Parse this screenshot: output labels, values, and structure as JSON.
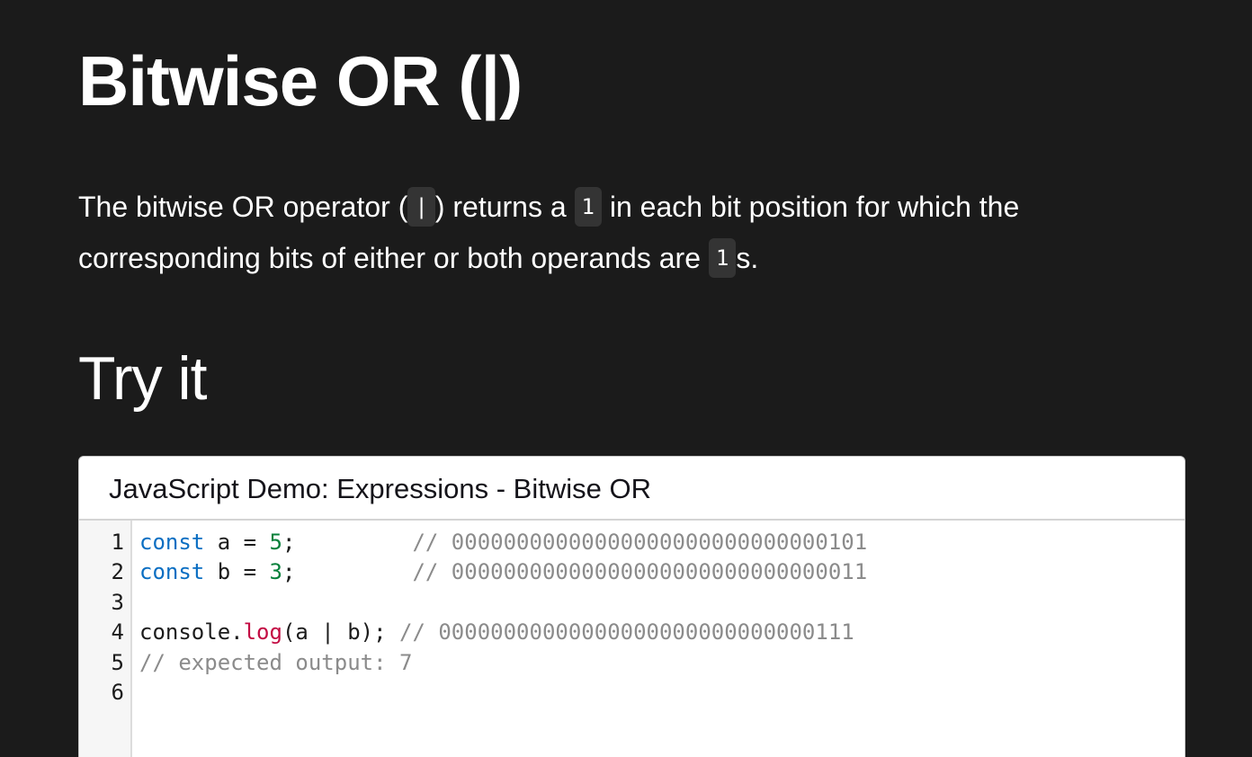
{
  "page": {
    "title": "Bitwise OR (|)",
    "intro": {
      "part1": "The bitwise OR operator (",
      "code1": "|",
      "part2": ") returns a ",
      "code2": "1",
      "part3": " in each bit position for which the corresponding bits of either or both operands are ",
      "code3": "1",
      "part4": "s."
    },
    "try_it_heading": "Try it"
  },
  "demo": {
    "header": "JavaScript Demo: Expressions - Bitwise OR",
    "line_numbers": [
      "1",
      "2",
      "3",
      "4",
      "5",
      "6"
    ],
    "lines": [
      [
        {
          "text": "const",
          "kind": "kw"
        },
        {
          "text": " a = ",
          "kind": "plain"
        },
        {
          "text": "5",
          "kind": "num"
        },
        {
          "text": ";         ",
          "kind": "plain"
        },
        {
          "text": "// 00000000000000000000000000000101",
          "kind": "cm"
        }
      ],
      [
        {
          "text": "const",
          "kind": "kw"
        },
        {
          "text": " b = ",
          "kind": "plain"
        },
        {
          "text": "3",
          "kind": "num"
        },
        {
          "text": ";         ",
          "kind": "plain"
        },
        {
          "text": "// 00000000000000000000000000000011",
          "kind": "cm"
        }
      ],
      [],
      [
        {
          "text": "console.",
          "kind": "plain"
        },
        {
          "text": "log",
          "kind": "fn"
        },
        {
          "text": "(a | b); ",
          "kind": "plain"
        },
        {
          "text": "// 00000000000000000000000000000111",
          "kind": "cm"
        }
      ],
      [
        {
          "text": "// expected output: 7",
          "kind": "cm"
        }
      ],
      []
    ]
  },
  "colors": {
    "background": "#1b1b1b",
    "keyword": "#0a6ec2",
    "number": "#06803b",
    "function": "#c30b43",
    "comment": "#8b8b8b"
  }
}
